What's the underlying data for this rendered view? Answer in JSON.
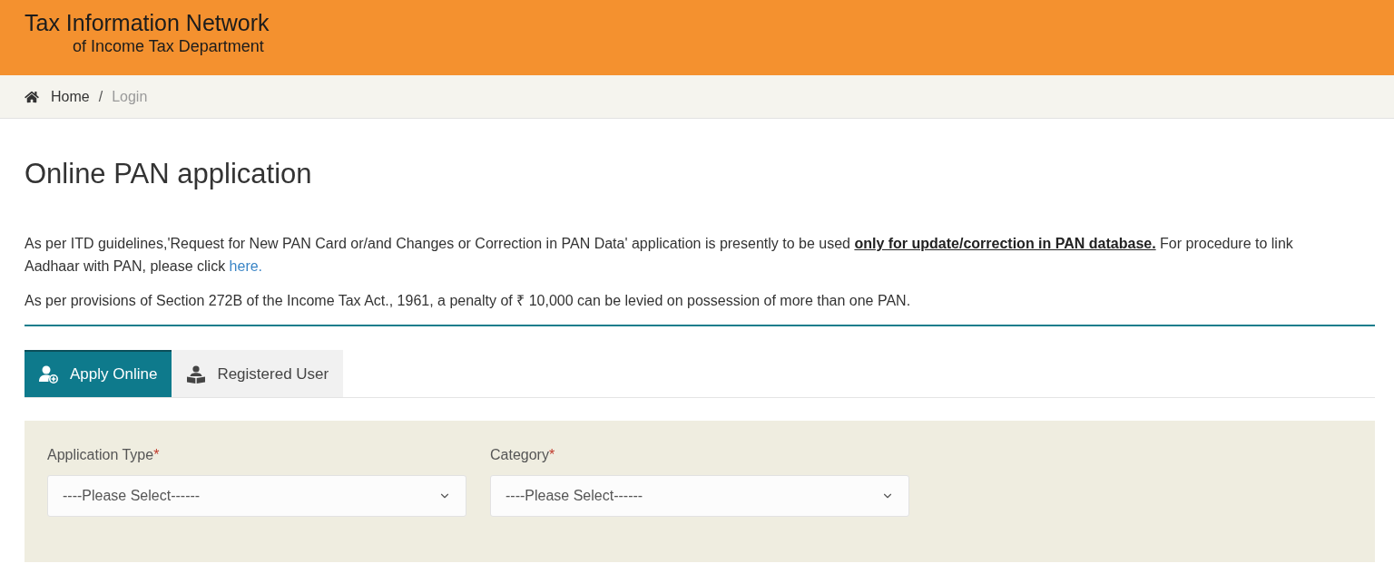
{
  "header": {
    "title": "Tax Information Network",
    "subtitle": "of Income Tax Department"
  },
  "breadcrumb": {
    "separator": "/",
    "items": [
      {
        "label": "Home",
        "current": false
      },
      {
        "label": "Login",
        "current": true
      }
    ]
  },
  "page_title": "Online PAN application",
  "notices": [
    {
      "text": "As per ITD guidelines,'Request for New PAN Card or/and Changes or Correction in PAN Data' application is presently to be used **only for update/correction in PAN database.** For procedure to link Aadhaar with PAN, please click",
      "link": "here."
    },
    {
      "text": "As per provisions of Section 272B of the Income Tax Act., 1961, a penalty of ₹ 10,000 can be levied on possession of more than one PAN."
    }
  ],
  "tabs": [
    {
      "label": "Apply Online",
      "selected": true
    },
    {
      "label": "Registered User",
      "selected": false
    }
  ],
  "form": {
    "fields": [
      {
        "label": "Application Type",
        "required_mark": "*",
        "value": "----Please Select------"
      },
      {
        "label": "Category",
        "required_mark": "*",
        "value": "----Please Select------"
      }
    ]
  }
}
